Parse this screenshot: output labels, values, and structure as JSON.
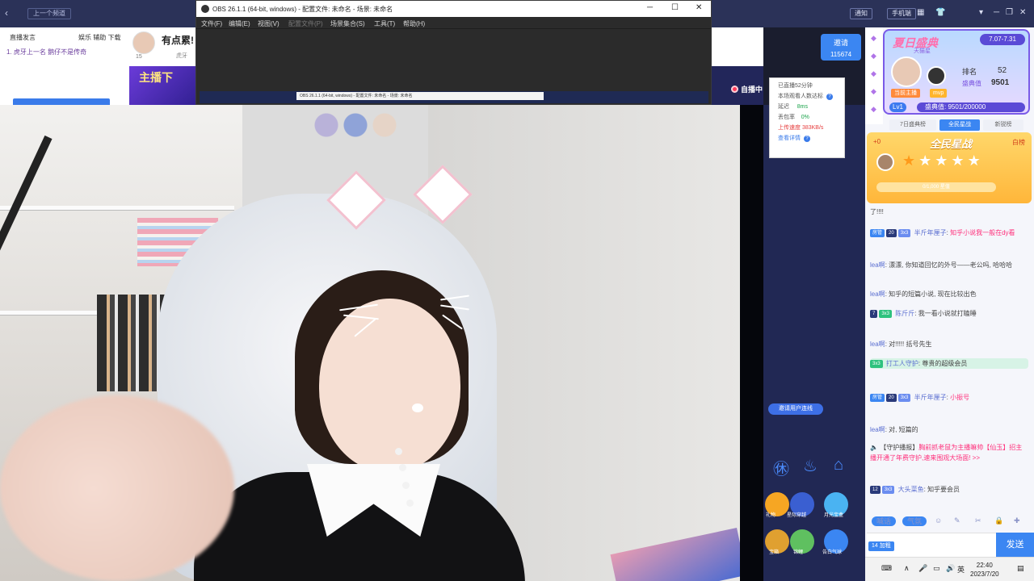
{
  "topbar": {
    "back_icon": "chevron-left",
    "crumb": "上一个频道",
    "notify": "通知",
    "phone": "手机端",
    "grid_icon": "grid",
    "skin_icon": "shirt",
    "menu_icon": "chevron-down",
    "min_icon": "minimize",
    "max_icon": "maximize",
    "close_icon": "close"
  },
  "left_panel": {
    "tab1": "直播发言",
    "tab2": "娱乐 辅助 下载",
    "row": "1. 虎牙上一名 鹅仔不是传奇"
  },
  "info_bar": {
    "title": "有点累!",
    "level": "15",
    "sub": "虎牙"
  },
  "promo": {
    "text": "主播下"
  },
  "invite": {
    "label": "邀请",
    "count": "115674"
  },
  "auto_live": "自播中",
  "obs": {
    "title": "OBS 26.1.1 (64-bit, windows) - 配置文件: 未命名 - 场景: 未命名",
    "menus": [
      "文件(F)",
      "编辑(E)",
      "视图(V)",
      "配置文件(P)",
      "场景集合(S)",
      "工具(T)",
      "帮助(H)"
    ],
    "disabled_menu_index": 3,
    "preview_title": "OBS 26.1.1 (64-bit, windows) - 配置文件: 未命名 - 场景: 未命名",
    "win_min": "─",
    "win_max": "☐",
    "win_close": "✕"
  },
  "stats": {
    "line1": "已直播52分钟",
    "line2": "本场观看人数达标",
    "latency_label": "延迟",
    "latency_value": "8ms",
    "loss_label": "丢包率",
    "loss_value": "0%",
    "upload_label": "上传速度",
    "upload_value": "383KB/s",
    "details": "查看详情"
  },
  "side_controls": {
    "go_button": "邀请用户连线",
    "gifts": [
      {
        "label": "礼物",
        "color": "#f6a623"
      },
      {
        "label": "星际穿越",
        "color": "#3a5fd1"
      },
      {
        "label": "月光宝盒",
        "color": "#4ab3f2"
      },
      {
        "label": "宝箱",
        "color": "#e0a030"
      },
      {
        "label": "锦鲤",
        "color": "#5fc060"
      },
      {
        "label": "告白气球",
        "color": "#3b86f2"
      }
    ]
  },
  "rank_card": {
    "brand": "夏日盛典",
    "sub": "天猫星",
    "date": "7.07-7.31",
    "host_tag": "当前主播",
    "mvp_tag": "mvp",
    "rank_label": "排名",
    "rank_value": "52",
    "score_label": "盛典值",
    "score_value": "9501",
    "level": "Lv1",
    "progress": "盛典值: 9501/200000",
    "tabs": [
      "7日盛典榜",
      "全民星战",
      "新锐榜"
    ]
  },
  "star_card": {
    "title": "全民星战",
    "fire": "+0",
    "tag": "白榜",
    "stars_filled": 1,
    "stars_total": 5,
    "progress_text": "0/1,000 星值"
  },
  "messages": [
    {
      "user": "",
      "text": "了!!!!",
      "hl": false
    },
    {
      "user": "半斤年厘子",
      "text": "知乎小说我一般在dy看",
      "badges": [
        "房管",
        "20",
        "3x3"
      ],
      "hl": true
    },
    {
      "user": "lea啊",
      "text": "漂漂, 你知道回忆的外号——老公吗, 哈哈哈",
      "badges": [],
      "hl": false
    },
    {
      "user": "lea啊",
      "text": "知乎的短篇小说, 现在比较出色",
      "badges": [],
      "hl": false
    },
    {
      "user": "陈斤斤",
      "text": "我一看小说就打瞌睡",
      "badges": [
        "7",
        "3x3"
      ],
      "hl": false
    },
    {
      "user": "lea啊",
      "text": "对!!!!! 括号先生",
      "badges": [],
      "hl": false
    },
    {
      "user": "打工人守护",
      "text": "尊贵的超级会员",
      "badges": [
        "3x3"
      ],
      "hl": false,
      "highlight_row": true
    },
    {
      "user": "半斤年厘子",
      "text": "小振号",
      "badges": [
        "房管",
        "20",
        "3x3"
      ],
      "hl": true
    },
    {
      "user": "lea啊",
      "text": "对, 短篇的",
      "badges": [],
      "hl": false
    },
    {
      "user": "【守护播报】",
      "text": "胸前抓老鼠为主播嘛帅【仙玉】招主播开通了年费守护,速来围观大场面! >>",
      "badges": [],
      "hl": false
    },
    {
      "user": "大头菜鱼",
      "text": "知乎要会员",
      "badges": [
        "12",
        "3x3"
      ],
      "hl": false
    }
  ],
  "chat_input": {
    "chip1": "喊话",
    "chip2": "气氛",
    "tag": "14 加粗",
    "send": "发送"
  },
  "taskbar": {
    "lang": "英",
    "time": "22:40",
    "date": "2023/7/20"
  }
}
